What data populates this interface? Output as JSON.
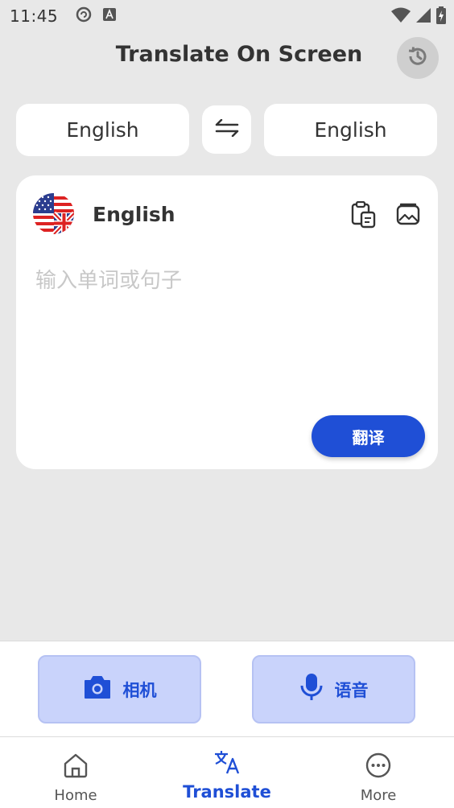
{
  "status_bar": {
    "time": "11:45",
    "icons": [
      "sync-icon",
      "font-icon",
      "wifi-icon",
      "signal-icon",
      "battery-icon"
    ]
  },
  "header": {
    "title": "Translate On Screen",
    "history_icon": "history-icon"
  },
  "language_selector": {
    "source": "English",
    "target": "English",
    "swap_icon": "swap-arrows-icon"
  },
  "input_card": {
    "language": "English",
    "flag_icon": "uk-us-flag-icon",
    "placeholder": "输入单词或句子",
    "value": "",
    "paste_icon": "paste-icon",
    "image_icon": "image-icon",
    "translate_label": "翻译"
  },
  "actions": {
    "camera_label": "相机",
    "voice_label": "语音"
  },
  "bottom_nav": {
    "items": [
      {
        "label": "Home",
        "icon": "home-icon"
      },
      {
        "label": "Translate",
        "icon": "translate-icon",
        "active": true
      },
      {
        "label": "More",
        "icon": "more-icon"
      }
    ]
  },
  "colors": {
    "accent": "#1f4fd6",
    "background": "#e8e8e8",
    "action_bg": "#c9d3fb"
  }
}
